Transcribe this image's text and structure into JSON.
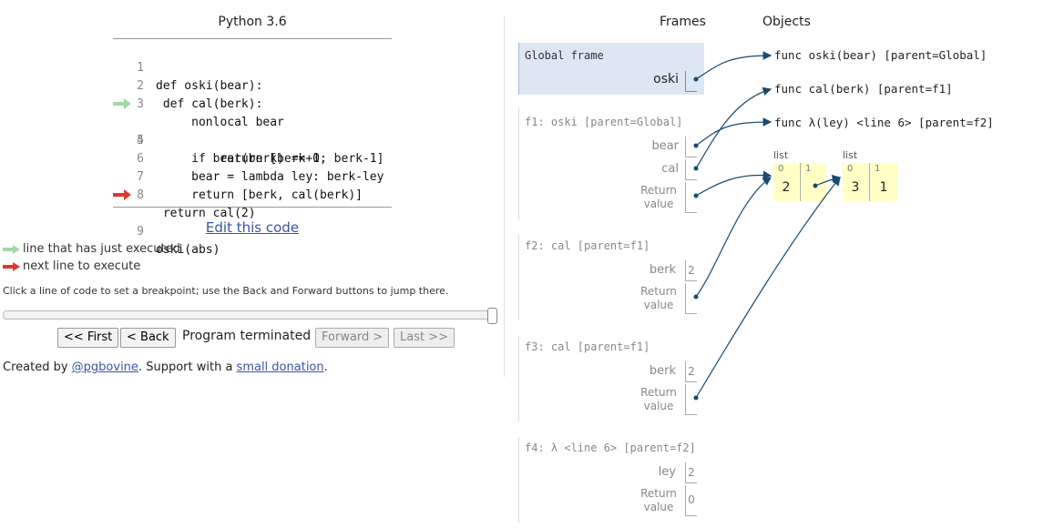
{
  "language": "Python 3.6",
  "code_lines": [
    {
      "num": "1",
      "text": "def oski(bear):"
    },
    {
      "num": "2",
      "text": " def cal(berk):"
    },
    {
      "num": "3",
      "text": "     nonlocal bear"
    },
    {
      "num": "4",
      "text": "     if bear(berk) == 0:"
    },
    {
      "num": "5",
      "text": "         return [berk+1, berk-1]"
    },
    {
      "num": "6",
      "text": "     bear = lambda ley: berk-ley"
    },
    {
      "num": "7",
      "text": "     return [berk, cal(berk)]"
    },
    {
      "num": "8",
      "text": " return cal(2)"
    },
    {
      "num": "9",
      "text": "oski(abs)"
    }
  ],
  "edit_link": "Edit this code",
  "legend": {
    "executed": "line that has just executed",
    "next": "next line to execute"
  },
  "hint": "Click a line of code to set a breakpoint; use the Back and Forward buttons to jump there.",
  "controls": {
    "first": "<< First",
    "back": "< Back",
    "status": "Program terminated",
    "forward": "Forward >",
    "last": "Last >>",
    "slider_fraction": 1.0
  },
  "credit": {
    "prefix": "Created by ",
    "author": "@pgbovine",
    "middle": ". Support with a ",
    "donation": "small donation",
    "suffix": "."
  },
  "headers": {
    "frames": "Frames",
    "objects": "Objects"
  },
  "frames": {
    "global": {
      "title": "Global frame",
      "var": "oski"
    },
    "f1": {
      "title": "f1: oski [parent=Global]",
      "vars": [
        "bear",
        "cal"
      ],
      "return": "Return\nvalue"
    },
    "f2": {
      "title": "f2: cal [parent=f1]",
      "var": "berk",
      "var_val": "2",
      "return": "Return\nvalue"
    },
    "f3": {
      "title": "f3: cal [parent=f1]",
      "var": "berk",
      "var_val": "2",
      "return": "Return\nvalue"
    },
    "f4": {
      "title": "f4: λ <line 6> [parent=f2]",
      "var": "ley",
      "var_val": "2",
      "return": "Return\nvalue",
      "return_val": "0"
    }
  },
  "objects": {
    "func_oski": "func oski(bear) [parent=Global]",
    "func_cal": "func cal(berk) [parent=f1]",
    "func_lambda": "func λ(ley) <line 6> [parent=f2]",
    "list1": {
      "tag": "list",
      "idx0": "0",
      "idx1": "1",
      "val0": "2"
    },
    "list2": {
      "tag": "list",
      "idx0": "0",
      "idx1": "1",
      "val0": "3",
      "val1": "1"
    }
  },
  "colors": {
    "executed_arrow": "#a2d9a2",
    "next_arrow": "#e0382e",
    "pointer": "#1a4a70",
    "list_fill": "#ffffc6",
    "frame_highlight": "#dde7f4"
  }
}
